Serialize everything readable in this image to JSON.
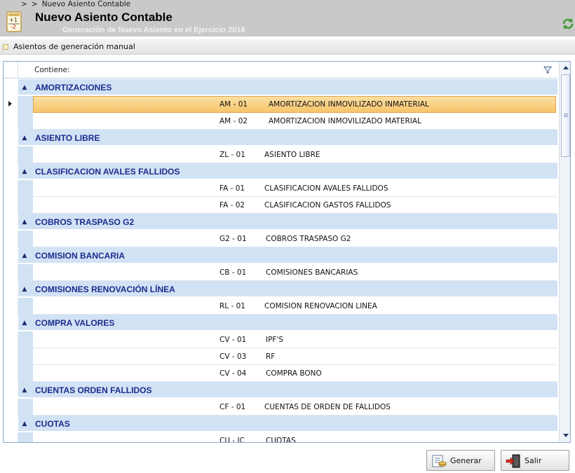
{
  "breadcrumb": {
    "sep1": ">",
    "sep2": ">",
    "current": "Nuevo Asiento Contable"
  },
  "header": {
    "title": "Nuevo Asiento Contable",
    "subtitle": "Generación de Nuevo Asiento en el Ejercicio 2016",
    "icon": "calculator-icon",
    "refresh_icon": "refresh-icon"
  },
  "section": {
    "label": "Asientos de generación manual"
  },
  "grid": {
    "column_header": "Contiene:",
    "groups": [
      {
        "label": "AMORTIZACIONES",
        "items": [
          {
            "code": "AM - 01",
            "desc": "AMORTIZACION INMOVILIZADO INMATERIAL",
            "selected": true
          },
          {
            "code": "AM - 02",
            "desc": "AMORTIZACION INMOVILIZADO MATERIAL"
          }
        ]
      },
      {
        "label": "ASIENTO LIBRE",
        "items": [
          {
            "code": "ZL - 01",
            "desc": "ASIENTO LIBRE"
          }
        ]
      },
      {
        "label": "CLASIFICACION AVALES FALLIDOS",
        "items": [
          {
            "code": "FA - 01",
            "desc": "CLASIFICACION AVALES FALLIDOS"
          },
          {
            "code": "FA - 02",
            "desc": "CLASIFICACION GASTOS FALLIDOS"
          }
        ]
      },
      {
        "label": "COBROS TRASPASO G2",
        "items": [
          {
            "code": "G2 - 01",
            "desc": "COBROS TRASPASO G2"
          }
        ]
      },
      {
        "label": "COMISION BANCARIA",
        "items": [
          {
            "code": "CB - 01",
            "desc": "COMISIONES BANCARIAS"
          }
        ]
      },
      {
        "label": "COMISIONES RENOVACIÓN LÍNEA",
        "items": [
          {
            "code": "RL - 01",
            "desc": "COMISION RENOVACION LINEA"
          }
        ]
      },
      {
        "label": "COMPRA VALORES",
        "items": [
          {
            "code": "CV - 01",
            "desc": "IPF'S"
          },
          {
            "code": "CV - 03",
            "desc": "RF"
          },
          {
            "code": "CV - 04",
            "desc": "COMPRA BONO"
          }
        ]
      },
      {
        "label": "CUENTAS ORDEN FALLIDOS",
        "items": [
          {
            "code": "CF - 01",
            "desc": "CUENTAS DE ORDEN DE FALLIDOS"
          }
        ]
      },
      {
        "label": "CUOTAS",
        "items": [
          {
            "code": "CU - IC",
            "desc": "CUOTAS"
          }
        ]
      }
    ]
  },
  "buttons": {
    "generar": "Generar",
    "salir": "Salir"
  },
  "colors": {
    "group_bg": "#d2e2f5",
    "group_text": "#1a2c8c",
    "selected_bg": "#f7c46b",
    "header_bg": "#c9c9c9"
  }
}
